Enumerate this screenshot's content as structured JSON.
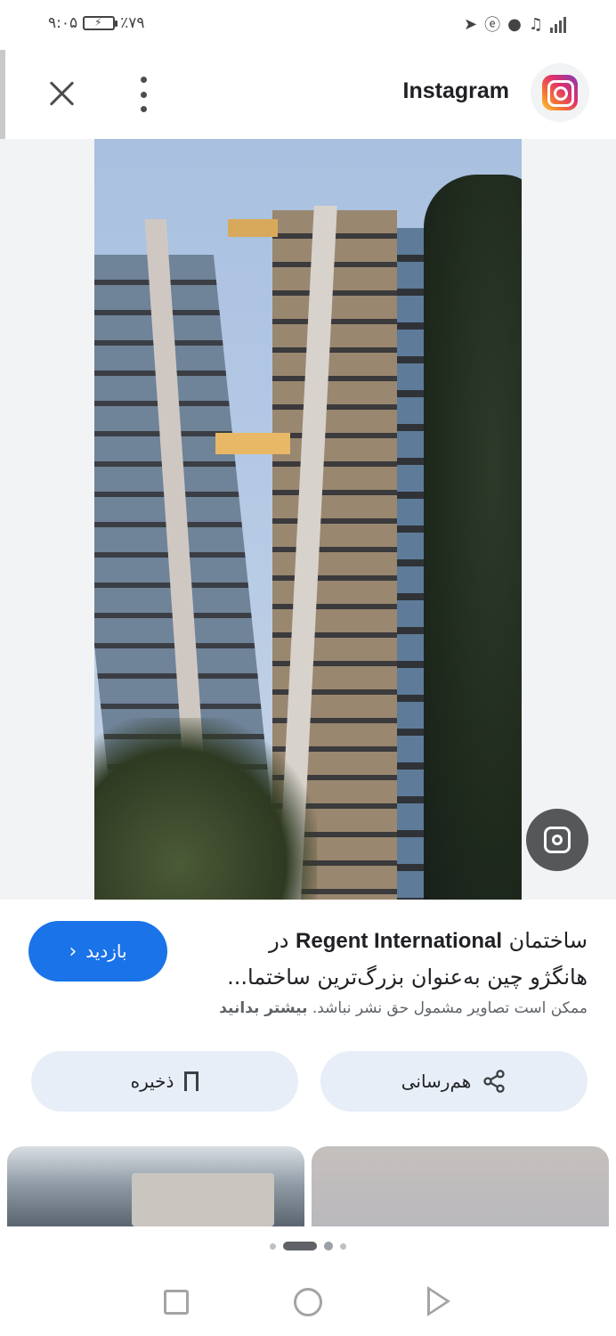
{
  "status_bar": {
    "time": "۹:۰۵",
    "battery": "٪۷۹"
  },
  "header": {
    "app_name": "Instagram"
  },
  "result": {
    "title_line1_pre": "ساختمان ",
    "title_line1_bold": "Regent International",
    "title_line1_post": " در",
    "title_line2": "هانگژو چین به‌عنوان بزرگ‌ترین ساختما...",
    "copyright_text": "ممکن است تصاویر مشمول حق نشر نباشد.",
    "learn_more": "بیشتر بدانید",
    "visit_label": "بازدید"
  },
  "actions": {
    "share_label": "هم‌رسانی",
    "save_label": "ذخیره"
  },
  "pagination": {
    "total": 4,
    "active_index": 1
  }
}
